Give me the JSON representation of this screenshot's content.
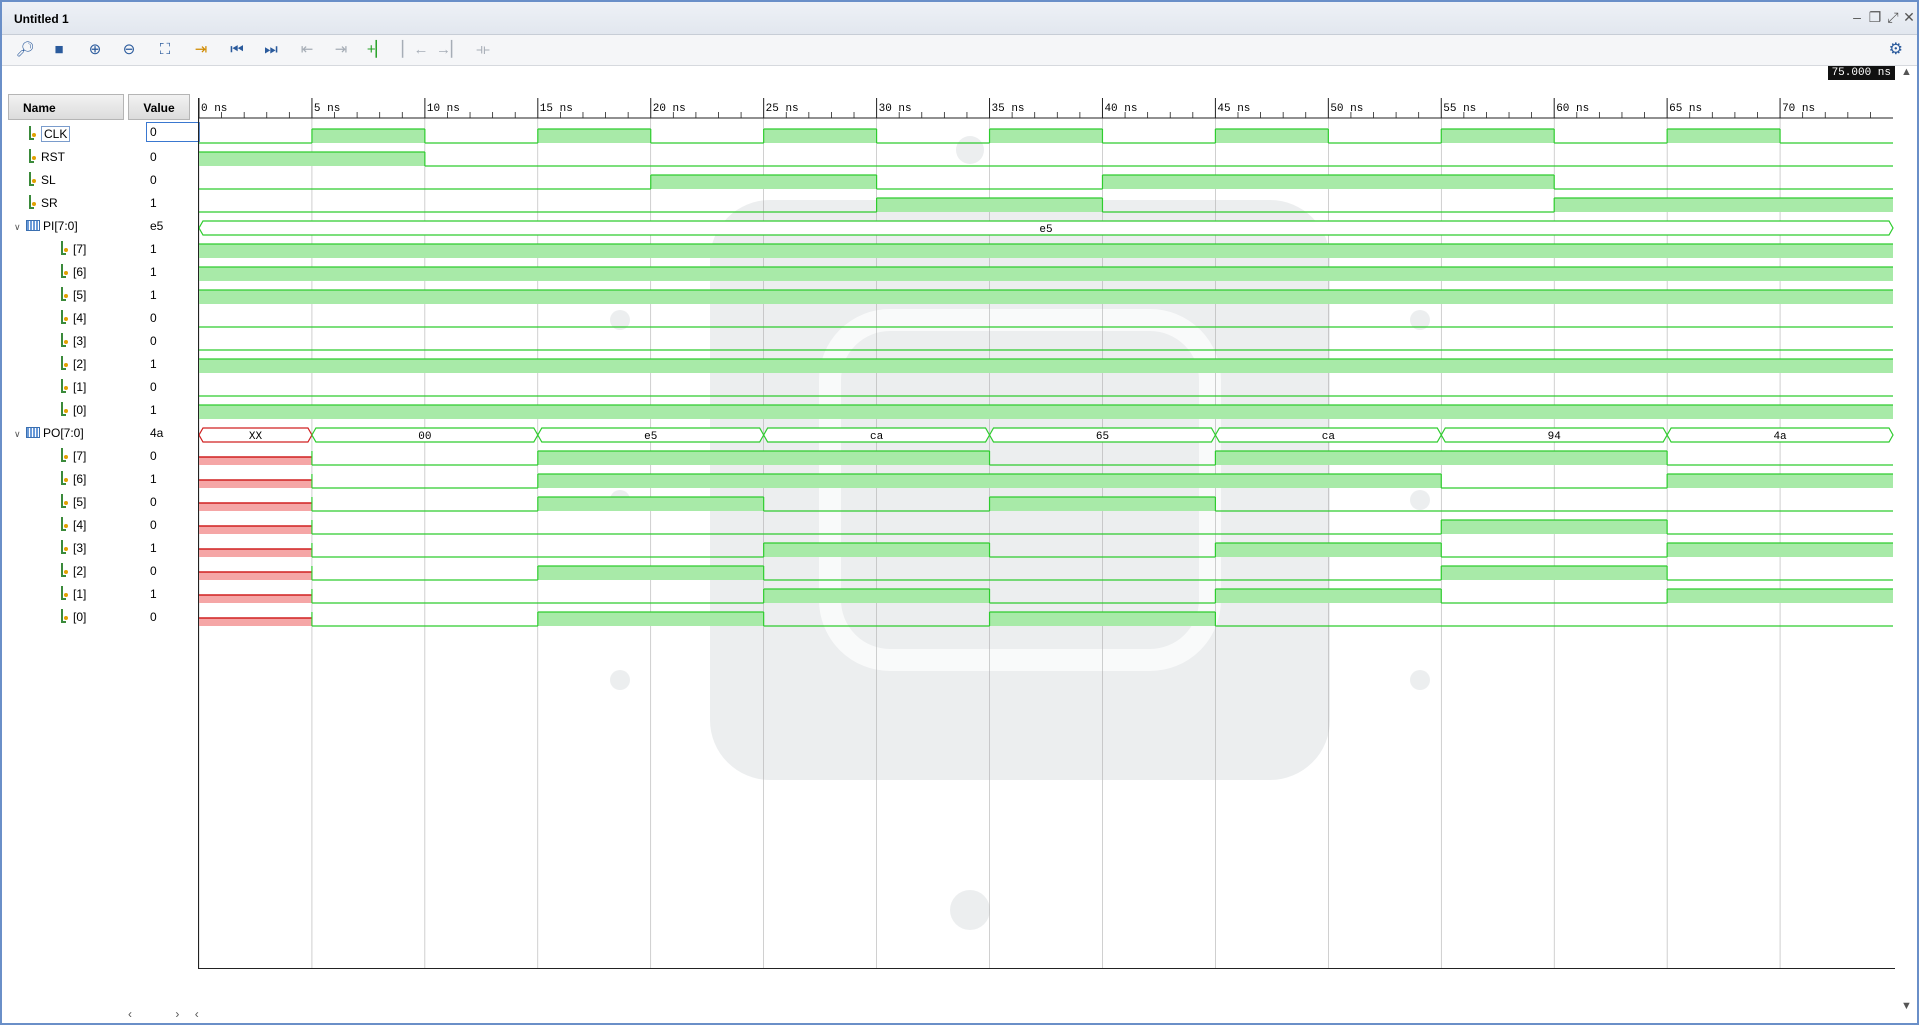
{
  "window": {
    "title": "Untitled 1"
  },
  "toolbar": {
    "icons": [
      "search-icon",
      "save-icon",
      "zoom-in-icon",
      "zoom-out-icon",
      "zoom-fit-icon",
      "go-to-cursor-icon",
      "go-to-start-icon",
      "go-to-end-icon",
      "previous-transition-icon",
      "next-transition-icon",
      "add-marker-icon",
      "previous-marker-icon",
      "next-marker-icon",
      "swap-cursors-icon"
    ],
    "settings_icon": "gear-icon"
  },
  "columns": {
    "name": "Name",
    "value": "Value"
  },
  "cursor_time": "75.000 ns",
  "timeline": {
    "ticks": [
      "0 ns",
      "5 ns",
      "10 ns",
      "15 ns",
      "20 ns",
      "25 ns",
      "30 ns",
      "35 ns",
      "40 ns",
      "45 ns",
      "50 ns",
      "55 ns",
      "60 ns",
      "65 ns",
      "70 ns"
    ],
    "max_ns": 75
  },
  "signals": [
    {
      "name": "CLK",
      "value": "0",
      "kind": "bit",
      "level": 0,
      "wave": [
        [
          0,
          0
        ],
        [
          5,
          1
        ],
        [
          10,
          0
        ],
        [
          15,
          1
        ],
        [
          20,
          0
        ],
        [
          25,
          1
        ],
        [
          30,
          0
        ],
        [
          35,
          1
        ],
        [
          40,
          0
        ],
        [
          45,
          1
        ],
        [
          50,
          0
        ],
        [
          55,
          1
        ],
        [
          60,
          0
        ],
        [
          65,
          1
        ],
        [
          70,
          0
        ]
      ]
    },
    {
      "name": "RST",
      "value": "0",
      "kind": "bit",
      "level": 0,
      "wave": [
        [
          0,
          1
        ],
        [
          10,
          0
        ]
      ]
    },
    {
      "name": "SL",
      "value": "0",
      "kind": "bit",
      "level": 0,
      "wave": [
        [
          0,
          0
        ],
        [
          20,
          1
        ],
        [
          30,
          0
        ],
        [
          40,
          1
        ],
        [
          60,
          0
        ]
      ]
    },
    {
      "name": "SR",
      "value": "1",
      "kind": "bit",
      "level": 0,
      "wave": [
        [
          0,
          0
        ],
        [
          30,
          1
        ],
        [
          40,
          0
        ],
        [
          60,
          1
        ]
      ]
    },
    {
      "name": "PI[7:0]",
      "value": "e5",
      "kind": "bus",
      "level": 0,
      "expanded": true,
      "segments": [
        {
          "start": 0,
          "end": 75,
          "label": "e5",
          "x": false
        }
      ]
    },
    {
      "name": "[7]",
      "value": "1",
      "kind": "bit",
      "level": 1,
      "wave": [
        [
          0,
          1
        ]
      ]
    },
    {
      "name": "[6]",
      "value": "1",
      "kind": "bit",
      "level": 1,
      "wave": [
        [
          0,
          1
        ]
      ]
    },
    {
      "name": "[5]",
      "value": "1",
      "kind": "bit",
      "level": 1,
      "wave": [
        [
          0,
          1
        ]
      ]
    },
    {
      "name": "[4]",
      "value": "0",
      "kind": "bit",
      "level": 1,
      "wave": [
        [
          0,
          0
        ]
      ]
    },
    {
      "name": "[3]",
      "value": "0",
      "kind": "bit",
      "level": 1,
      "wave": [
        [
          0,
          0
        ]
      ]
    },
    {
      "name": "[2]",
      "value": "1",
      "kind": "bit",
      "level": 1,
      "wave": [
        [
          0,
          1
        ]
      ]
    },
    {
      "name": "[1]",
      "value": "0",
      "kind": "bit",
      "level": 1,
      "wave": [
        [
          0,
          0
        ]
      ]
    },
    {
      "name": "[0]",
      "value": "1",
      "kind": "bit",
      "level": 1,
      "wave": [
        [
          0,
          1
        ]
      ]
    },
    {
      "name": "PO[7:0]",
      "value": "4a",
      "kind": "bus",
      "level": 0,
      "expanded": true,
      "segments": [
        {
          "start": 0,
          "end": 5,
          "label": "XX",
          "x": true
        },
        {
          "start": 5,
          "end": 15,
          "label": "00",
          "x": false
        },
        {
          "start": 15,
          "end": 25,
          "label": "e5",
          "x": false
        },
        {
          "start": 25,
          "end": 35,
          "label": "ca",
          "x": false
        },
        {
          "start": 35,
          "end": 45,
          "label": "65",
          "x": false
        },
        {
          "start": 45,
          "end": 55,
          "label": "ca",
          "x": false
        },
        {
          "start": 55,
          "end": 65,
          "label": "94",
          "x": false
        },
        {
          "start": 65,
          "end": 75,
          "label": "4a",
          "x": false
        }
      ]
    },
    {
      "name": "[7]",
      "value": "0",
      "kind": "bit",
      "level": 1,
      "wave": [
        [
          0,
          "x"
        ],
        [
          5,
          0
        ],
        [
          15,
          1
        ],
        [
          35,
          0
        ],
        [
          45,
          1
        ],
        [
          65,
          0
        ]
      ]
    },
    {
      "name": "[6]",
      "value": "1",
      "kind": "bit",
      "level": 1,
      "wave": [
        [
          0,
          "x"
        ],
        [
          5,
          0
        ],
        [
          15,
          1
        ],
        [
          55,
          0
        ],
        [
          65,
          1
        ]
      ]
    },
    {
      "name": "[5]",
      "value": "0",
      "kind": "bit",
      "level": 1,
      "wave": [
        [
          0,
          "x"
        ],
        [
          5,
          0
        ],
        [
          15,
          1
        ],
        [
          25,
          0
        ],
        [
          35,
          1
        ],
        [
          45,
          0
        ]
      ]
    },
    {
      "name": "[4]",
      "value": "0",
      "kind": "bit",
      "level": 1,
      "wave": [
        [
          0,
          "x"
        ],
        [
          5,
          0
        ],
        [
          55,
          1
        ],
        [
          65,
          0
        ]
      ]
    },
    {
      "name": "[3]",
      "value": "1",
      "kind": "bit",
      "level": 1,
      "wave": [
        [
          0,
          "x"
        ],
        [
          5,
          0
        ],
        [
          25,
          1
        ],
        [
          35,
          0
        ],
        [
          45,
          1
        ],
        [
          55,
          0
        ],
        [
          65,
          1
        ]
      ]
    },
    {
      "name": "[2]",
      "value": "0",
      "kind": "bit",
      "level": 1,
      "wave": [
        [
          0,
          "x"
        ],
        [
          5,
          0
        ],
        [
          15,
          1
        ],
        [
          25,
          0
        ],
        [
          55,
          1
        ],
        [
          65,
          0
        ]
      ]
    },
    {
      "name": "[1]",
      "value": "1",
      "kind": "bit",
      "level": 1,
      "wave": [
        [
          0,
          "x"
        ],
        [
          5,
          0
        ],
        [
          25,
          1
        ],
        [
          35,
          0
        ],
        [
          45,
          1
        ],
        [
          55,
          0
        ],
        [
          65,
          1
        ]
      ]
    },
    {
      "name": "[0]",
      "value": "0",
      "kind": "bit",
      "level": 1,
      "wave": [
        [
          0,
          "x"
        ],
        [
          5,
          0
        ],
        [
          15,
          1
        ],
        [
          25,
          0
        ],
        [
          35,
          1
        ],
        [
          45,
          0
        ]
      ]
    }
  ],
  "colors": {
    "high_fill": "#a8eaa8",
    "wave_line": "#2ecc2e",
    "x_fill": "#f5a6a6",
    "x_line": "#d02020",
    "grid": "#b0b0b0"
  },
  "scroll": {
    "left": "‹",
    "right": "›"
  }
}
